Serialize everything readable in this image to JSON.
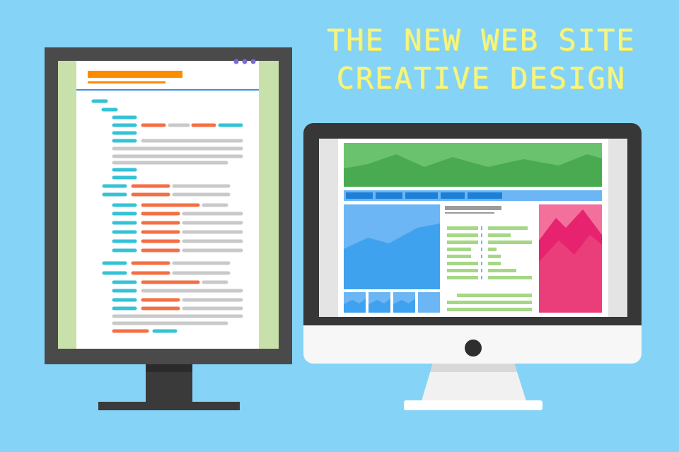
{
  "headline": {
    "line1": "THE NEW WEB SITE",
    "line2": "CREATIVE DESIGN"
  },
  "colors": {
    "background": "#85d3f7",
    "headline": "#f4f582",
    "monitor_frame": "#4a4a4a",
    "code_teal": "#35c2d6",
    "code_orange": "#f36f44",
    "code_gray": "#c9c9c9",
    "site_green": "#5cb860",
    "site_blue": "#3fa2ee",
    "site_pink": "#ea3e7b",
    "site_lime": "#a6d785"
  },
  "icons": [
    "window-dots-icon",
    "mountain-chart-icon",
    "imac-camera-icon"
  ]
}
